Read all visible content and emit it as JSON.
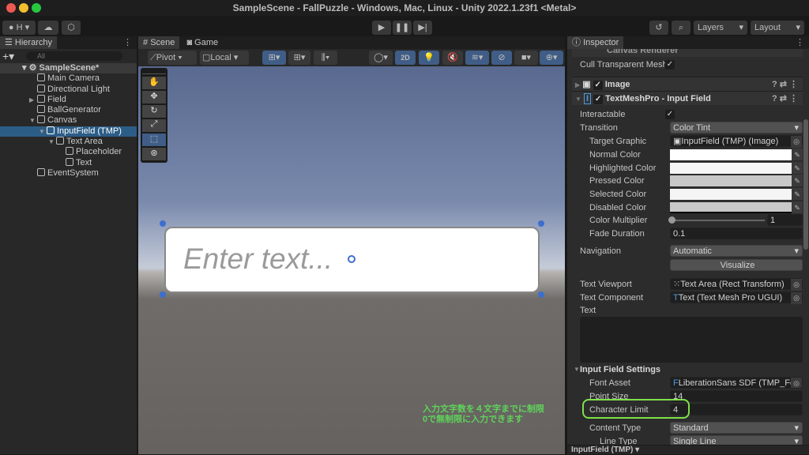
{
  "window": {
    "title": "SampleScene - FallPuzzle - Windows, Mac, Linux - Unity 2022.1.23f1 <Metal>"
  },
  "toolbar": {
    "account_label": "H",
    "layers_label": "Layers",
    "layout_label": "Layout"
  },
  "hierarchy": {
    "tab": "Hierarchy",
    "search_placeholder": "All",
    "scene": "SampleScene*",
    "items": [
      {
        "label": "Main Camera"
      },
      {
        "label": "Directional Light"
      },
      {
        "label": "Field"
      },
      {
        "label": "BallGenerator"
      },
      {
        "label": "Canvas"
      },
      {
        "label": "InputField (TMP)"
      },
      {
        "label": "Text Area"
      },
      {
        "label": "Placeholder"
      },
      {
        "label": "Text"
      },
      {
        "label": "EventSystem"
      }
    ]
  },
  "scene": {
    "tabs": [
      "Scene",
      "Game"
    ],
    "pivot": "Pivot",
    "local": "Local",
    "mode_2d": "2D",
    "placeholder_text": "Enter text...",
    "annotation_line1": "入力文字数を４文字までに制限",
    "annotation_line2": "0で無制限に入力できます",
    "annotation_color": "#5fd35a"
  },
  "inspector": {
    "tab": "Inspector",
    "canvas_renderer": "Canvas Renderer",
    "cull_label": "Cull Transparent Mesh",
    "image_component": "Image",
    "input_component": "TextMeshPro - Input Field",
    "interactable_label": "Interactable",
    "transition_label": "Transition",
    "transition_value": "Color Tint",
    "target_graphic_label": "Target Graphic",
    "target_graphic_value": "InputField (TMP) (Image)",
    "normal_color_label": "Normal Color",
    "highlighted_color_label": "Highlighted Color",
    "pressed_color_label": "Pressed Color",
    "selected_color_label": "Selected Color",
    "disabled_color_label": "Disabled Color",
    "colors": {
      "normal": "#ffffff",
      "highlighted": "#f5f5f5",
      "pressed": "#c8c8c8",
      "selected": "#f5f5f5",
      "disabled": "#c8c8c8"
    },
    "color_multiplier_label": "Color Multiplier",
    "color_multiplier_value": "1",
    "fade_duration_label": "Fade Duration",
    "fade_duration_value": "0.1",
    "navigation_label": "Navigation",
    "navigation_value": "Automatic",
    "visualize_label": "Visualize",
    "text_viewport_label": "Text Viewport",
    "text_viewport_value": "Text Area (Rect Transform)",
    "text_component_label": "Text Component",
    "text_component_value": "Text (Text Mesh Pro UGUI)",
    "text_label": "Text",
    "text_value": "",
    "settings_header": "Input Field Settings",
    "font_asset_label": "Font Asset",
    "font_asset_value": "LiberationSans SDF (TMP_Fon",
    "point_size_label": "Point Size",
    "point_size_value": "14",
    "char_limit_label": "Character Limit",
    "char_limit_value": "4",
    "content_type_label": "Content Type",
    "content_type_value": "Standard",
    "line_type_label": "Line Type",
    "line_type_value": "Single Line",
    "footer_label": "InputField (TMP)",
    "highlight_color": "#7ee04a"
  }
}
